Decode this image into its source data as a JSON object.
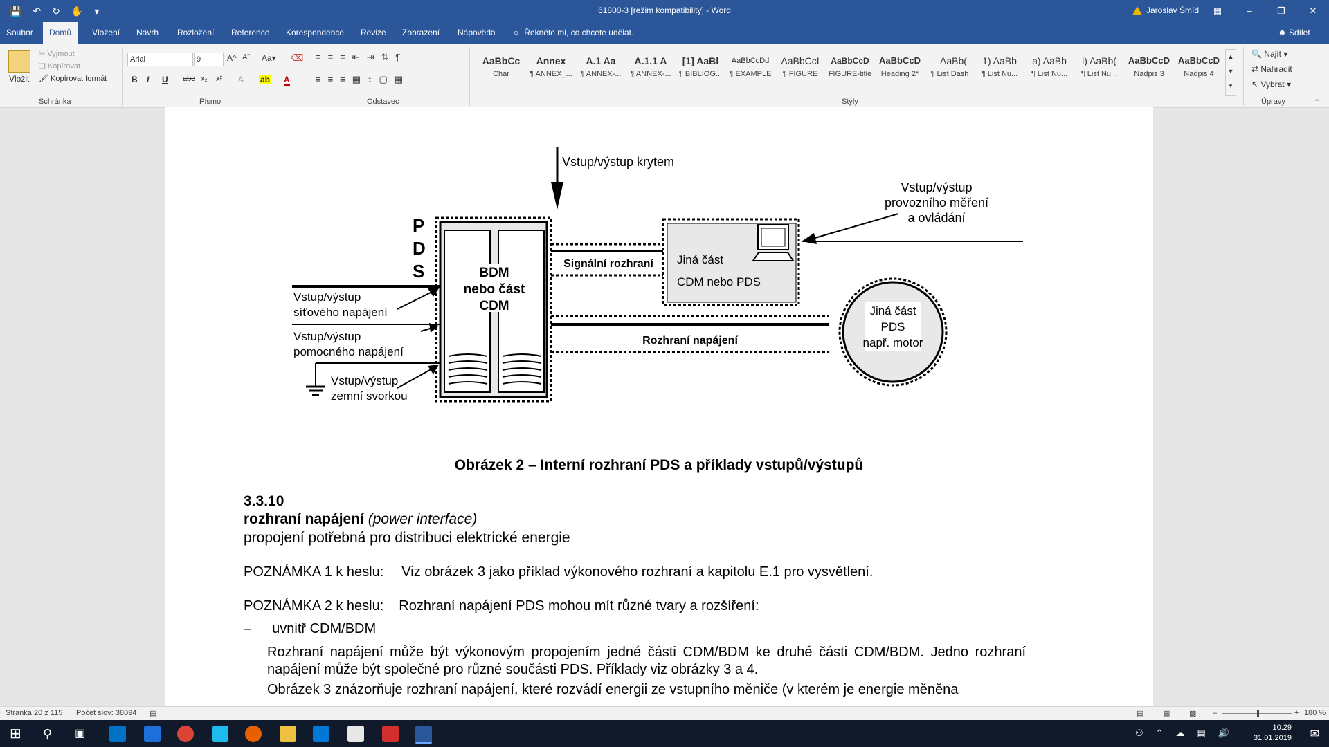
{
  "window": {
    "title": "61800-3 [režim kompatibility] - Word",
    "user": "Jaroslav Šmíd"
  },
  "tabs": [
    "Soubor",
    "Domů",
    "Vložení",
    "Návrh",
    "Rozložení",
    "Reference",
    "Korespondence",
    "Revize",
    "Zobrazení",
    "Nápověda"
  ],
  "tellme": "Řekněte mi, co chcete udělat.",
  "share": "Sdílet",
  "ribbon": {
    "clipboard": {
      "paste": "Vložit",
      "cut": "Vyjmout",
      "copy": "Kopírovat",
      "format_painter": "Kopírovat formát",
      "label": "Schránka"
    },
    "font": {
      "name": "Arial",
      "size": "9",
      "label": "Písmo"
    },
    "paragraph": {
      "label": "Odstavec"
    },
    "styles": {
      "label": "Styly",
      "items": [
        {
          "preview": "AaBbCc",
          "name": "Char"
        },
        {
          "preview": "Annex",
          "name": "¶ ANNEX_..."
        },
        {
          "preview": "A.1  Aa",
          "name": "¶ ANNEX-..."
        },
        {
          "preview": "A.1.1  A",
          "name": "¶ ANNEX-..."
        },
        {
          "preview": "[1]  AaBl",
          "name": "¶ BIBLIOG..."
        },
        {
          "preview": "AaBbCcDd",
          "name": "¶ EXAMPLE"
        },
        {
          "preview": "AaBbCcI",
          "name": "¶ FIGURE"
        },
        {
          "preview": "AaBbCcD",
          "name": "FIGURE-title"
        },
        {
          "preview": "AaBbCcD",
          "name": "Heading 2*"
        },
        {
          "preview": "– AaBb(",
          "name": "¶ List Dash"
        },
        {
          "preview": "1)  AaBb",
          "name": "¶ List Nu..."
        },
        {
          "preview": "a)  AaBb",
          "name": "¶ List Nu..."
        },
        {
          "preview": "i)  AaBb(",
          "name": "¶ List Nu..."
        },
        {
          "preview": "AaBbCcD",
          "name": "Nadpis 3"
        },
        {
          "preview": "AaBbCcD",
          "name": "Nadpis 4"
        }
      ]
    },
    "editing": {
      "find": "Najít",
      "replace": "Nahradit",
      "select": "Vybrat",
      "label": "Úpravy"
    }
  },
  "figure": {
    "pds_letters": [
      "P",
      "D",
      "S"
    ],
    "cover_io": "Vstup/výstup krytem",
    "operation_io": [
      "Vstup/výstup",
      "provozního měření",
      "a ovládání"
    ],
    "bdm": [
      "BDM",
      "nebo část",
      "CDM"
    ],
    "signal_interface": "Signální rozhraní",
    "other_cdm": [
      "Jiná část",
      "CDM nebo PDS"
    ],
    "power_interface": "Rozhraní napájení",
    "motor": [
      "Jiná část",
      "PDS",
      "např. motor"
    ],
    "mains_io": [
      "Vstup/výstup",
      "síťového napájení"
    ],
    "aux_io": [
      "Vstup/výstup",
      "pomocného napájení"
    ],
    "earth_io": [
      "Vstup/výstup",
      "zemní svorkou"
    ],
    "caption": "Obrázek 2 – Interní rozhraní PDS a příklady vstupů/výstupů"
  },
  "document": {
    "clause_number": "3.3.10",
    "term": "rozhraní napájení",
    "term_en": "(power interface)",
    "definition": "propojení potřebná pro distribuci elektrické energie",
    "note1_label": "POZNÁMKA 1 k heslu:",
    "note1_text": "Viz obrázek 3 jako příklad výkonového rozhraní a kapitolu E.1 pro vysvětlení.",
    "note2_label": "POZNÁMKA 2 k heslu:",
    "note2_text": "Rozhraní napájení PDS mohou mít různé tvary a rozšíření:",
    "dash": "–",
    "list_item": "uvnitř CDM/BDM",
    "para1": "Rozhraní napájení může být výkonovým propojením jedné části CDM/BDM ke druhé části CDM/BDM. Jedno rozhraní napájení může být společné pro různé součásti PDS. Příklady viz obrázky 3 a 4.",
    "para2": "Obrázek 3 znázorňuje rozhraní napájení, které rozvádí energii ze vstupního měniče (v kterém je energie měněna"
  },
  "status": {
    "page": "Stránka 20 z 115",
    "words": "Počet slov: 38094",
    "zoom": "180 %"
  },
  "clock": {
    "time": "10:29",
    "date": "31.01.2019"
  },
  "colors": {
    "word_blue": "#2b579a",
    "ribbon_bg": "#f3f3f3",
    "figure_fill": "#e8e8e8",
    "taskbar": "#101a2b"
  }
}
